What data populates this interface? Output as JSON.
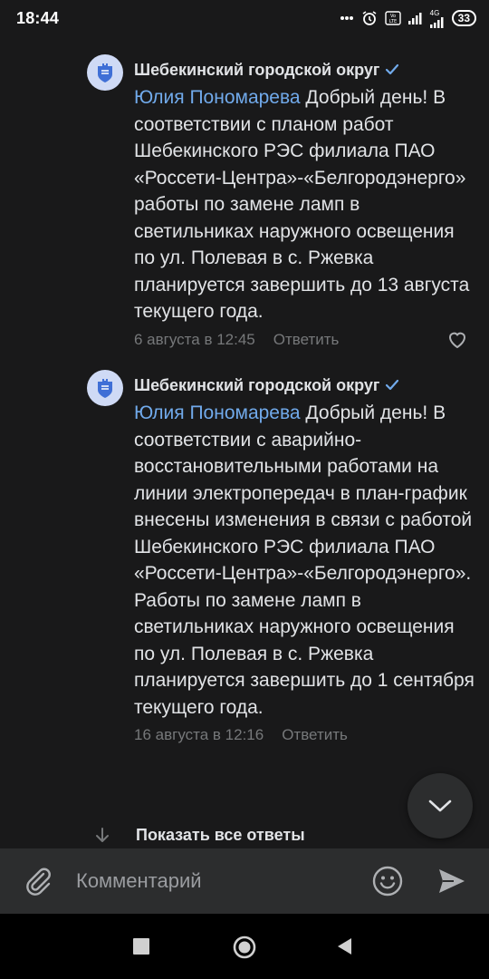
{
  "status_bar": {
    "time": "18:44",
    "network_label": "4G",
    "battery": "33",
    "icons": [
      "dots-icon",
      "alarm-icon",
      "volte-icon",
      "signal-icon",
      "signal-4g-icon",
      "battery-icon"
    ]
  },
  "comments": [
    {
      "author": "Шебекинский городской округ",
      "verified": true,
      "reply_to": "Юлия Пономарева",
      "text": " Добрый день! В соответствии с планом работ Шебекинского РЭС филиала ПАО «Россети-Центра»-«Белгородэнерго» работы по замене ламп в светильниках наружного освещения по ул. Полевая в с. Ржевка планируется завершить до 13 августа текущего года.",
      "date": "6 августа в 12:45",
      "reply_label": "Ответить"
    },
    {
      "author": "Шебекинский городской округ",
      "verified": true,
      "reply_to": "Юлия Пономарева",
      "text": " Добрый день! В соответствии с аварийно-восстановительными работами на линии электропередач в план-график внесены изменения в связи с работой Шебекинского РЭС филиала ПАО «Россети-Центра»-«Белгородэнерго». Работы по замене ламп в светильниках наружного освещения по ул. Полевая в с. Ржевка планируется завершить до 1 сентября текущего года.",
      "date": "16 августа в 12:16",
      "reply_label": "Ответить"
    }
  ],
  "show_all_label": "Показать все ответы",
  "composer": {
    "placeholder": "Комментарий"
  },
  "colors": {
    "background": "#19191a",
    "accent": "#71aaeb",
    "verified": "#71aaeb",
    "secondary_text": "#76787a",
    "composer_bg": "#2c2d2e"
  }
}
